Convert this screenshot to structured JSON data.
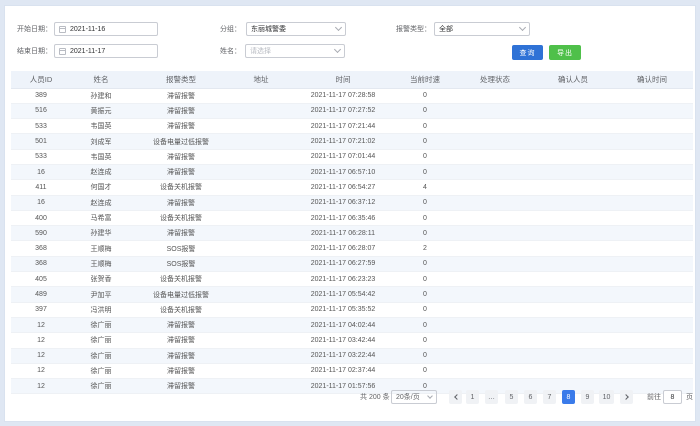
{
  "filters": {
    "start_label": "开始日期：",
    "start_value": "2021-11-16",
    "end_label": "结束日期：",
    "end_value": "2021-11-17",
    "group_label": "分组：",
    "group_value": "东丽城警委",
    "name_label": "姓名：",
    "name_placeholder": "请选择",
    "alarm_type_label": "报警类型：",
    "alarm_type_value": "全部"
  },
  "buttons": {
    "query": "查询",
    "export": "导出"
  },
  "table": {
    "headers": [
      "人员ID",
      "姓名",
      "报警类型",
      "地址",
      "时间",
      "当前时速",
      "处理状态",
      "确认人员",
      "确认时间"
    ],
    "rows": [
      [
        "389",
        "孙建和",
        "滞留报警",
        "",
        "2021-11-17 07:28:58",
        "0",
        "",
        "",
        ""
      ],
      [
        "516",
        "黄振元",
        "滞留报警",
        "",
        "2021-11-17 07:27:52",
        "0",
        "",
        "",
        ""
      ],
      [
        "533",
        "韦国英",
        "滞留报警",
        "",
        "2021-11-17 07:21:44",
        "0",
        "",
        "",
        ""
      ],
      [
        "501",
        "刘成军",
        "设备电量过低报警",
        "",
        "2021-11-17 07:21:02",
        "0",
        "",
        "",
        ""
      ],
      [
        "533",
        "韦国英",
        "滞留报警",
        "",
        "2021-11-17 07:01:44",
        "0",
        "",
        "",
        ""
      ],
      [
        "16",
        "赵连成",
        "滞留报警",
        "",
        "2021-11-17 06:57:10",
        "0",
        "",
        "",
        ""
      ],
      [
        "411",
        "何国才",
        "设备关机报警",
        "",
        "2021-11-17 06:54:27",
        "4",
        "",
        "",
        ""
      ],
      [
        "16",
        "赵连成",
        "滞留报警",
        "",
        "2021-11-17 06:37:12",
        "0",
        "",
        "",
        ""
      ],
      [
        "400",
        "马希富",
        "设备关机报警",
        "",
        "2021-11-17 06:35:46",
        "0",
        "",
        "",
        ""
      ],
      [
        "590",
        "孙建华",
        "滞留报警",
        "",
        "2021-11-17 06:28:11",
        "0",
        "",
        "",
        ""
      ],
      [
        "368",
        "王顺梅",
        "SOS报警",
        "",
        "2021-11-17 06:28:07",
        "2",
        "",
        "",
        ""
      ],
      [
        "368",
        "王顺梅",
        "SOS报警",
        "",
        "2021-11-17 06:27:59",
        "0",
        "",
        "",
        ""
      ],
      [
        "405",
        "张贺香",
        "设备关机报警",
        "",
        "2021-11-17 06:23:23",
        "0",
        "",
        "",
        ""
      ],
      [
        "489",
        "尹加平",
        "设备电量过低报警",
        "",
        "2021-11-17 05:54:42",
        "0",
        "",
        "",
        ""
      ],
      [
        "397",
        "冯洪明",
        "设备关机报警",
        "",
        "2021-11-17 05:35:52",
        "0",
        "",
        "",
        ""
      ],
      [
        "12",
        "徐广丽",
        "滞留报警",
        "",
        "2021-11-17 04:02:44",
        "0",
        "",
        "",
        ""
      ],
      [
        "12",
        "徐广丽",
        "滞留报警",
        "",
        "2021-11-17 03:42:44",
        "0",
        "",
        "",
        ""
      ],
      [
        "12",
        "徐广丽",
        "滞留报警",
        "",
        "2021-11-17 03:22:44",
        "0",
        "",
        "",
        ""
      ],
      [
        "12",
        "徐广丽",
        "滞留报警",
        "",
        "2021-11-17 02:37:44",
        "0",
        "",
        "",
        ""
      ],
      [
        "12",
        "徐广丽",
        "滞留报警",
        "",
        "2021-11-17 01:57:56",
        "0",
        "",
        "",
        ""
      ]
    ]
  },
  "pagination": {
    "total_text": "共 200 条",
    "page_size": "20条/页",
    "pages": [
      "1",
      "…",
      "5",
      "6",
      "7",
      "8",
      "9",
      "10"
    ],
    "current_page": "8",
    "goto_label": "前往",
    "goto_value": "8",
    "goto_unit": "页"
  },
  "colors": {
    "primary": "#2f72d6",
    "success": "#4fc04a",
    "active_page": "#3a7bea",
    "header_bg": "#eef3fa",
    "stripe_bg": "#f3f7fc"
  },
  "icons": {
    "date": "calendar-icon",
    "select": "chevron-down-icon",
    "prev": "chevron-left-icon",
    "next": "chevron-right-icon"
  }
}
